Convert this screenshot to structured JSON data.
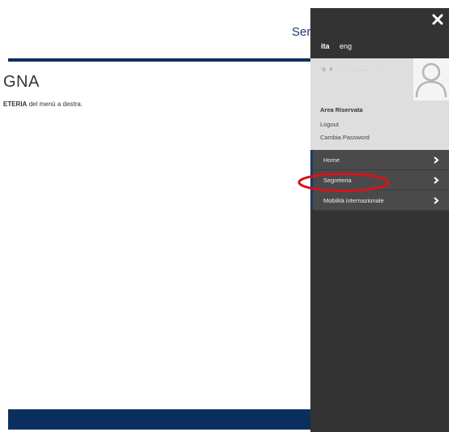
{
  "background_page": {
    "header_link": "Ser",
    "heading": "GNA",
    "instructions_bold": "ETERIA",
    "instructions_rest": " del menù a destra.",
    "rule_color": "#0c2e5e"
  },
  "side_menu": {
    "close_icon": "close-icon",
    "languages": [
      {
        "label": "ita",
        "active": true
      },
      {
        "label": "eng",
        "active": false
      }
    ],
    "user": {
      "name_redacted": "’B P      ·  · ·· ·····  · ··",
      "avatar_icon": "user-avatar-icon",
      "area_title": "Area Riservata",
      "links": [
        "Logout",
        "Cambia Password"
      ]
    },
    "items": [
      {
        "label": "Home"
      },
      {
        "label": "Segreteria"
      },
      {
        "label": "Mobilità internazionale"
      }
    ],
    "accent_color": "#1b3a6b",
    "highlight_color": "#d9121b"
  }
}
